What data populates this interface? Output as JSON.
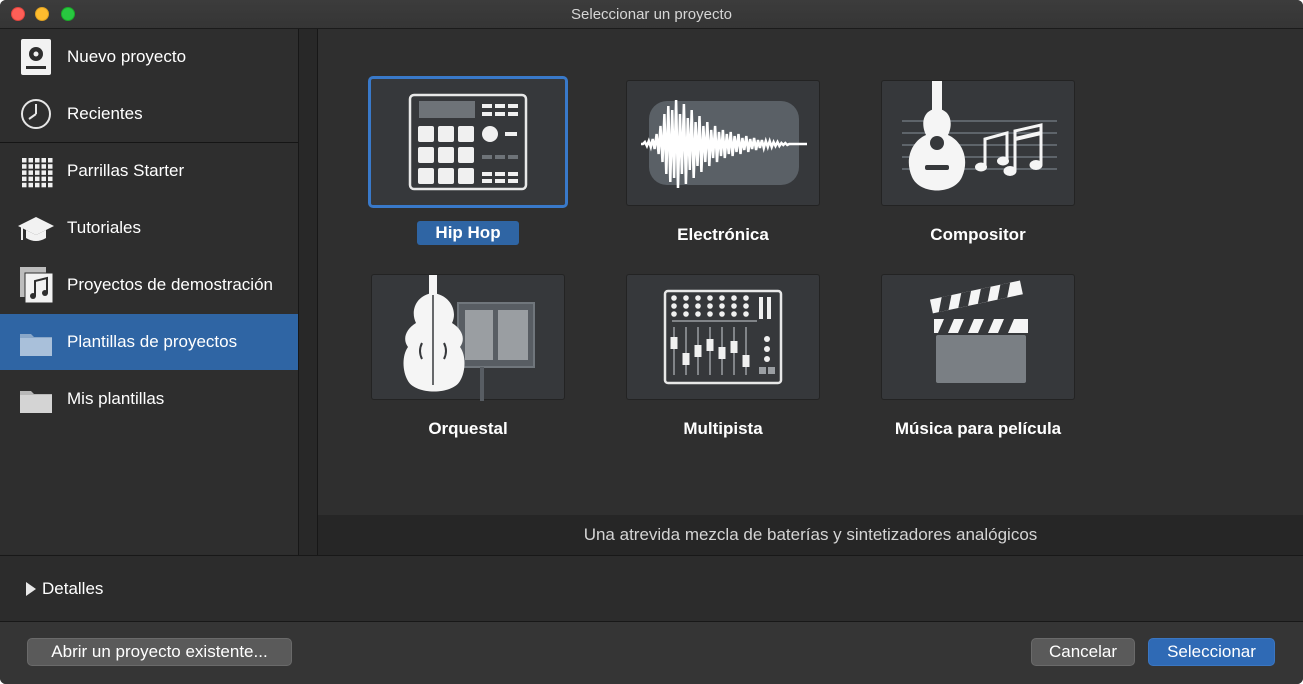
{
  "window": {
    "title": "Seleccionar un proyecto"
  },
  "sidebar": {
    "items": [
      {
        "label": "Nuevo proyecto",
        "icon": "new-project-icon"
      },
      {
        "label": "Recientes",
        "icon": "clock-icon"
      },
      {
        "label": "Parrillas Starter",
        "icon": "grid-icon"
      },
      {
        "label": "Tutoriales",
        "icon": "graduation-cap-icon"
      },
      {
        "label": "Proyectos de demostración",
        "icon": "music-note-icon"
      },
      {
        "label": "Plantillas de proyectos",
        "icon": "folder-icon",
        "selected": true
      },
      {
        "label": "Mis plantillas",
        "icon": "folder-icon"
      }
    ]
  },
  "templates": [
    {
      "label": "Hip Hop",
      "icon": "drum-machine-icon",
      "selected": true
    },
    {
      "label": "Electrónica",
      "icon": "waveform-icon"
    },
    {
      "label": "Compositor",
      "icon": "guitar-icon"
    },
    {
      "label": "Orquestal",
      "icon": "cello-icon"
    },
    {
      "label": "Multipista",
      "icon": "mixer-icon"
    },
    {
      "label": "Música para película",
      "icon": "clapperboard-icon"
    }
  ],
  "description": "Una atrevida mezcla de baterías y sintetizadores analógicos",
  "details": {
    "label": "Detalles"
  },
  "footer": {
    "open_existing": "Abrir un proyecto existente...",
    "cancel": "Cancelar",
    "select": "Seleccionar"
  },
  "colors": {
    "accent": "#2f65a4",
    "selected_border": "#3979c9"
  }
}
